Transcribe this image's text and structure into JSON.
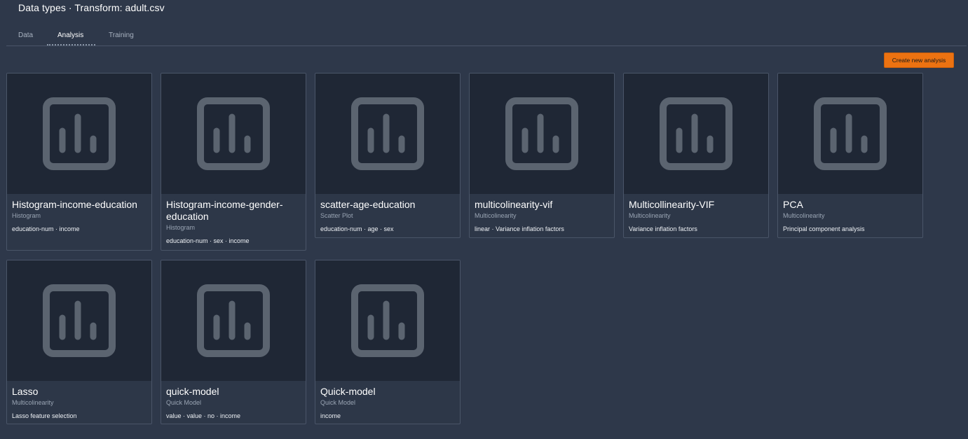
{
  "header": {
    "title": "Data types · Transform: adult.csv"
  },
  "tabs": [
    {
      "label": "Data"
    },
    {
      "label": "Analysis"
    },
    {
      "label": "Training"
    }
  ],
  "toolbar": {
    "create_label": "Create new analysis"
  },
  "cards": [
    {
      "title": "Histogram-income-education",
      "type": "Histogram",
      "tags": "education-num · income"
    },
    {
      "title": "Histogram-income-gender-education",
      "type": "Histogram",
      "tags": "education-num · sex · income"
    },
    {
      "title": "scatter-age-education",
      "type": "Scatter Plot",
      "tags": "education-num · age · sex"
    },
    {
      "title": "multicolinearity-vif",
      "type": "Multicolinearity",
      "tags": "linear · Variance inflation factors"
    },
    {
      "title": "Multicollinearity-VIF",
      "type": "Multicolinearity",
      "tags": "Variance inflation factors"
    },
    {
      "title": "PCA",
      "type": "Multicolinearity",
      "tags": "Principal component analysis"
    },
    {
      "title": "Lasso",
      "type": "Multicolinearity",
      "tags": "Lasso feature selection"
    },
    {
      "title": "quick-model",
      "type": "Quick Model",
      "tags": "value · value · no · income"
    },
    {
      "title": "Quick-model",
      "type": "Quick Model",
      "tags": "income"
    }
  ],
  "thumbnail_icon": "bar-chart-icon",
  "colors": {
    "background": "#2e384a",
    "thumbnail": "#1f2735",
    "icon": "#5b6470",
    "accent": "#ec7211"
  }
}
